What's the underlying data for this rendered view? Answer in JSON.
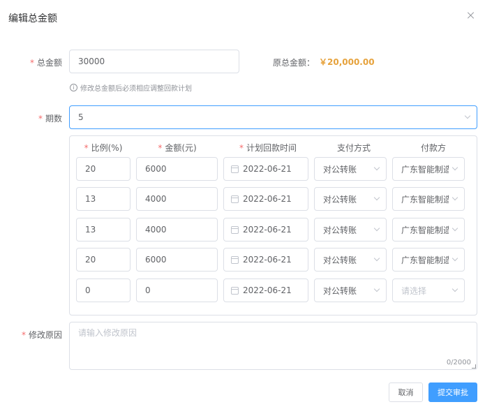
{
  "dialog": {
    "title": "编辑总金额"
  },
  "total_amount": {
    "required_mark": "*",
    "label": "总金额",
    "value": "30000",
    "original_label": "原总金额：",
    "original_value": "￥20,000.00",
    "hint_icon": "i",
    "hint": "修改总金额后必须相应调整回款计划"
  },
  "periods": {
    "required_mark": "*",
    "label": "期数",
    "value": "5"
  },
  "plan_table": {
    "headers": [
      {
        "required": "*",
        "text": "比例(%)"
      },
      {
        "required": "*",
        "text": "金额(元)"
      },
      {
        "required": "*",
        "text": "计划回款时间"
      },
      {
        "required": "",
        "text": "支付方式"
      },
      {
        "required": "",
        "text": "付款方"
      }
    ],
    "rows": [
      {
        "ratio": "20",
        "amount": "6000",
        "date": "2022-06-21",
        "method": "对公转账",
        "payer": "广东智能制造"
      },
      {
        "ratio": "13",
        "amount": "4000",
        "date": "2022-06-21",
        "method": "对公转账",
        "payer": "广东智能制造"
      },
      {
        "ratio": "13",
        "amount": "4000",
        "date": "2022-06-21",
        "method": "对公转账",
        "payer": "广东智能制造"
      },
      {
        "ratio": "20",
        "amount": "6000",
        "date": "2022-06-21",
        "method": "对公转账",
        "payer": "广东智能制造"
      },
      {
        "ratio": "0",
        "amount": "0",
        "date": "2022-06-21",
        "method": "对公转账",
        "payer": ""
      }
    ],
    "payer_placeholder": "请选择"
  },
  "reason": {
    "required_mark": "*",
    "label": "修改原因",
    "placeholder": "请输入修改原因",
    "counter": "0/2000"
  },
  "footer": {
    "cancel_label": "取消",
    "submit_label": "提交审批"
  }
}
